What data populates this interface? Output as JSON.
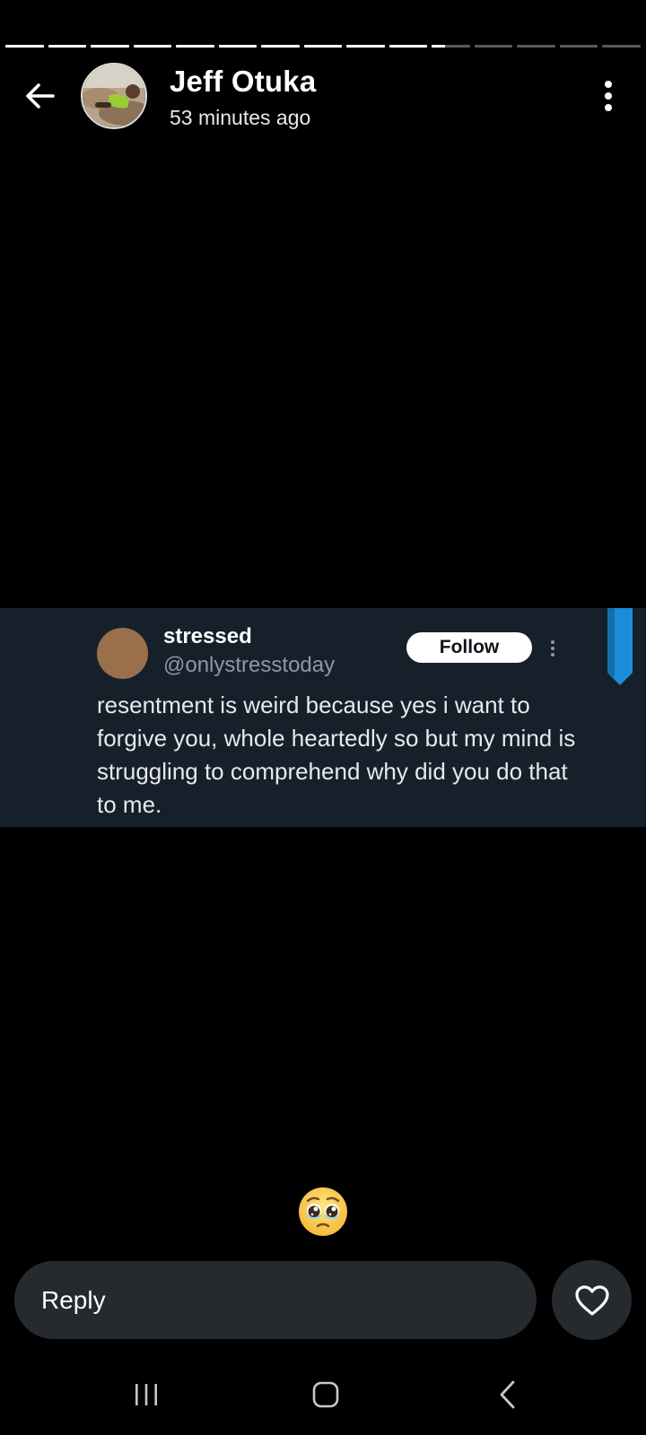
{
  "story": {
    "segment_progress": [
      1,
      1,
      1,
      1,
      1,
      1,
      1,
      1,
      1,
      1,
      0.35,
      0,
      0,
      0,
      0
    ],
    "user_name": "Jeff Otuka",
    "time_ago": "53 minutes ago",
    "icons": {
      "back": "arrow-left-icon",
      "more": "more-vertical-icon",
      "avatar": "profile-photo"
    }
  },
  "tweet": {
    "display_name": "stressed",
    "handle": "@onlystresstoday",
    "follow_label": "Follow",
    "text": "resentment is weird because yes i want to forgive you, whole heartedly so but my mind is struggling to comprehend why did you do that to me.",
    "colors": {
      "background": "#15202b",
      "avatar": "#9a6f4c",
      "handle": "#8b98a5",
      "ribbon": "#1d8cd8"
    }
  },
  "reaction": {
    "emoji": "pleading-face-emoji"
  },
  "reply": {
    "placeholder": "Reply",
    "like_icon": "heart-outline-icon"
  },
  "system_nav": {
    "recents_icon": "recents-icon",
    "home_icon": "home-icon",
    "back_icon": "back-chevron-icon"
  }
}
